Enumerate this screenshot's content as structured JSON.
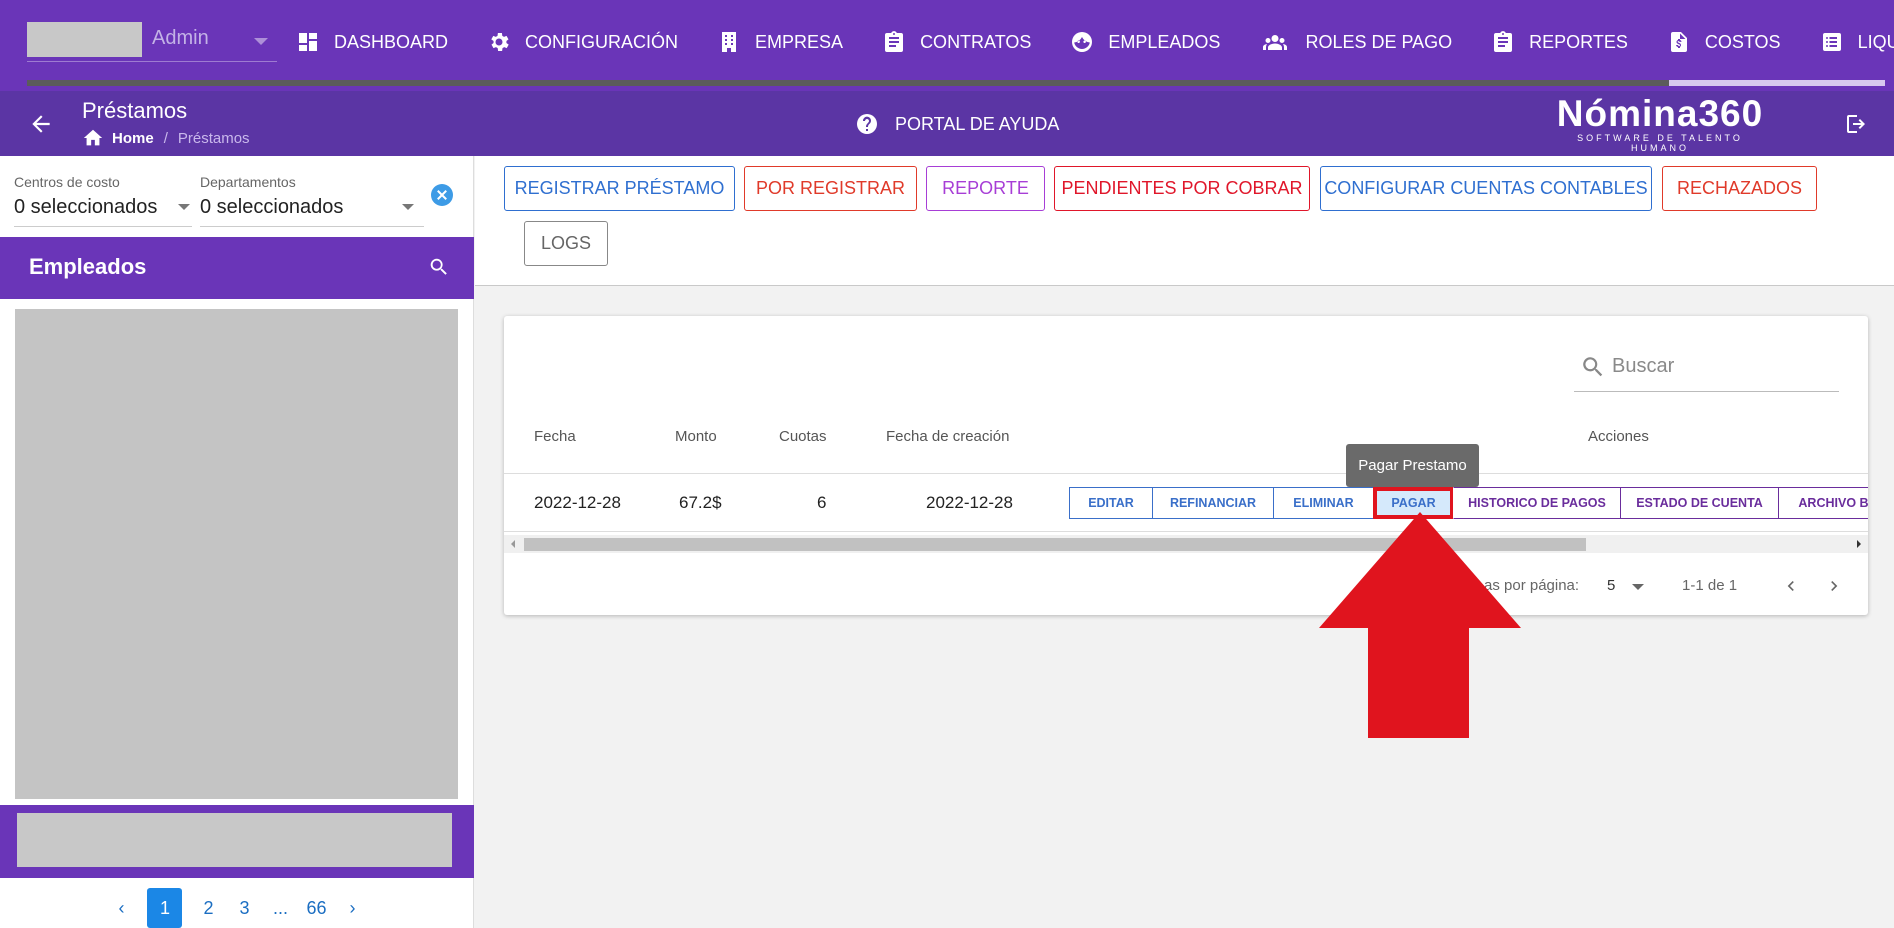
{
  "topnav": {
    "username": "Admin",
    "items": [
      {
        "label": "DASHBOARD",
        "icon": "dashboard-icon"
      },
      {
        "label": "CONFIGURACIÓN",
        "icon": "gear-icon"
      },
      {
        "label": "EMPRESA",
        "icon": "building-icon"
      },
      {
        "label": "CONTRATOS",
        "icon": "clipboard-icon"
      },
      {
        "label": "EMPLEADOS",
        "icon": "face-icon"
      },
      {
        "label": "ROLES DE PAGO",
        "icon": "people-icon"
      },
      {
        "label": "REPORTES",
        "icon": "clipboard-icon"
      },
      {
        "label": "COSTOS",
        "icon": "invoice-icon"
      },
      {
        "label": "LIQUIDACIONE",
        "icon": "list-icon"
      }
    ]
  },
  "subheader": {
    "title": "Préstamos",
    "breadcrumb_home": "Home",
    "breadcrumb_sep": "/",
    "breadcrumb_current": "Préstamos",
    "help_label": "PORTAL DE AYUDA",
    "logo_main": "Nómina360",
    "logo_sub": "SOFTWARE DE TALENTO HUMANO"
  },
  "filters": {
    "cost_centers_label": "Centros de costo",
    "cost_centers_value": "0 seleccionados",
    "departments_label": "Departamentos",
    "departments_value": "0 seleccionados"
  },
  "employees": {
    "title": "Empleados",
    "pages": [
      "1",
      "2",
      "3",
      "...",
      "66"
    ],
    "prev": "‹",
    "next": "›"
  },
  "toolbar": {
    "buttons": [
      {
        "label": "REGISTRAR PRÉSTAMO",
        "color": "#2f6fd0"
      },
      {
        "label": "POR REGISTRAR",
        "color": "#e03a2a"
      },
      {
        "label": "REPORTE",
        "color": "#a73ed6"
      },
      {
        "label": "PENDIENTES POR COBRAR",
        "color": "#e0162a"
      },
      {
        "label": "CONFIGURAR CUENTAS CONTABLES",
        "color": "#2f6fd0"
      },
      {
        "label": "RECHAZADOS",
        "color": "#e03a2a"
      },
      {
        "label": "LOGS",
        "color": "#666666"
      }
    ]
  },
  "table": {
    "search_placeholder": "Buscar",
    "headers": [
      "Fecha",
      "Monto",
      "Cuotas",
      "Fecha de creación",
      "Acciones"
    ],
    "rows": [
      {
        "fecha": "2022-12-28",
        "monto": "67.2$",
        "cuotas": "6",
        "fecha_creacion": "2022-12-28"
      }
    ],
    "actions": [
      "EDITAR",
      "REFINANCIAR",
      "ELIMINAR",
      "PAGAR",
      "HISTORICO DE PAGOS",
      "ESTADO DE CUENTA",
      "ARCHIVO BA"
    ],
    "rows_per_page_label": "as por página:",
    "rows_per_page_value": "5",
    "range": "1-1 de 1"
  },
  "tooltip": "Pagar Prestamo",
  "colors": {
    "nav_bg": "#6a35b8",
    "subheader_bg": "#5b35a4",
    "arrow": "#e0141e"
  }
}
